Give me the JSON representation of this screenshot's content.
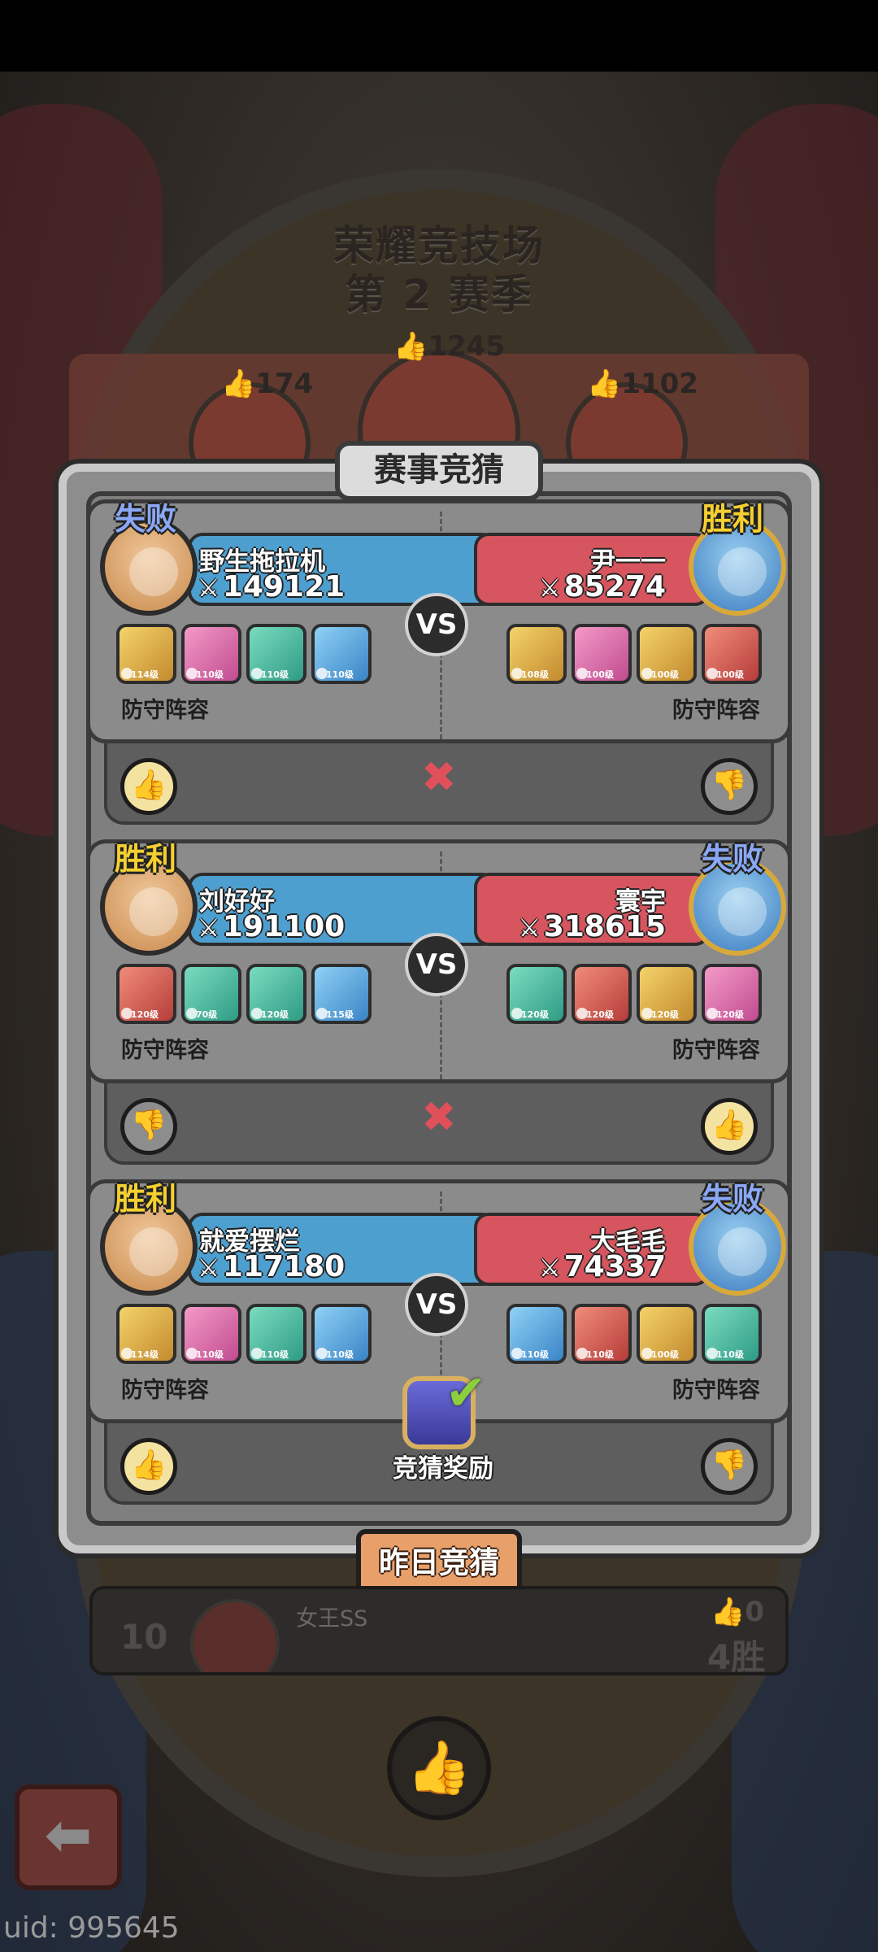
{
  "arena": {
    "title": "荣耀竞技场",
    "season": "第 2 赛季",
    "podium_likes": [
      "174",
      "1245",
      "1102"
    ]
  },
  "panel": {
    "title": "赛事竞猜",
    "team_label": "防守阵容",
    "vs": "VS",
    "cross_icon": "✖",
    "reward_label": "竞猜奖励",
    "yesterday_button": "昨日竞猜"
  },
  "matches": [
    {
      "left": {
        "result": "失败",
        "result_type": "lose",
        "name": "野生拖拉机",
        "power": "149121",
        "heroes": [
          {
            "lv": "114级",
            "c": "c-gold"
          },
          {
            "lv": "110级",
            "c": "c-pink"
          },
          {
            "lv": "110级",
            "c": "c-teal"
          },
          {
            "lv": "110级",
            "c": "c-blue"
          }
        ]
      },
      "right": {
        "result": "胜利",
        "result_type": "win",
        "name": "尹一一",
        "power": "85274",
        "heroes": [
          {
            "lv": "108级",
            "c": "c-gold"
          },
          {
            "lv": "100级",
            "c": "c-pink"
          },
          {
            "lv": "100级",
            "c": "c-gold"
          },
          {
            "lv": "100级",
            "c": "c-red"
          }
        ]
      },
      "bet": {
        "left_thumb": "up",
        "right_thumb": "down"
      }
    },
    {
      "left": {
        "result": "胜利",
        "result_type": "win",
        "name": "刘好好",
        "power": "191100",
        "heroes": [
          {
            "lv": "120级",
            "c": "c-red"
          },
          {
            "lv": "70级",
            "c": "c-teal"
          },
          {
            "lv": "120级",
            "c": "c-teal"
          },
          {
            "lv": "115级",
            "c": "c-blue"
          }
        ]
      },
      "right": {
        "result": "失败",
        "result_type": "lose",
        "name": "寰宇",
        "power": "318615",
        "heroes": [
          {
            "lv": "120级",
            "c": "c-teal"
          },
          {
            "lv": "120级",
            "c": "c-red"
          },
          {
            "lv": "120级",
            "c": "c-gold"
          },
          {
            "lv": "120级",
            "c": "c-pink"
          }
        ]
      },
      "bet": {
        "left_thumb": "down",
        "right_thumb": "up"
      }
    },
    {
      "left": {
        "result": "胜利",
        "result_type": "win",
        "name": "就爱摆烂",
        "power": "117180",
        "heroes": [
          {
            "lv": "114级",
            "c": "c-gold"
          },
          {
            "lv": "110级",
            "c": "c-pink"
          },
          {
            "lv": "110级",
            "c": "c-teal"
          },
          {
            "lv": "110级",
            "c": "c-blue"
          }
        ]
      },
      "right": {
        "result": "失败",
        "result_type": "lose",
        "name": "大毛毛",
        "power": "74337",
        "heroes": [
          {
            "lv": "110级",
            "c": "c-blue"
          },
          {
            "lv": "110级",
            "c": "c-red"
          },
          {
            "lv": "100级",
            "c": "c-gold"
          },
          {
            "lv": "110级",
            "c": "c-teal"
          }
        ]
      },
      "bet": {
        "left_thumb": "up",
        "right_thumb": "down"
      }
    }
  ],
  "rank_row": {
    "rank": "10",
    "name": "女王SS",
    "likes": "0",
    "wins": "4胜"
  },
  "uid": "uid: 995645",
  "icons": {
    "thumb_up": "👍",
    "thumb_down": "👎",
    "back_arrow": "⬅",
    "power": "⚔"
  }
}
